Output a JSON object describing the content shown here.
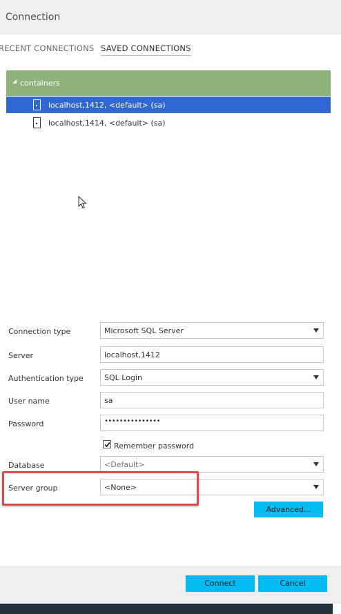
{
  "dialog": {
    "title": "Connection"
  },
  "tabs": [
    {
      "label": "RECENT CONNECTIONS",
      "active": false
    },
    {
      "label": "SAVED CONNECTIONS",
      "active": true
    }
  ],
  "tree": {
    "group_label": "containers",
    "items": [
      {
        "label": "localhost,1412, <default> (sa)",
        "selected": true,
        "icon": "server-icon"
      },
      {
        "label": "localhost,1414, <default> (sa)",
        "selected": false,
        "icon": "server-icon"
      }
    ]
  },
  "form": {
    "connection_type": {
      "label": "Connection type",
      "value": "Microsoft SQL Server"
    },
    "server": {
      "label": "Server",
      "value": "localhost,1412"
    },
    "auth_type": {
      "label": "Authentication type",
      "value": "SQL Login"
    },
    "user_name": {
      "label": "User name",
      "value": "sa"
    },
    "password": {
      "label": "Password",
      "value": "•••••••••••••••"
    },
    "remember_password": {
      "label": "Remember password",
      "checked": true
    },
    "database": {
      "label": "Database",
      "value": "<Default>"
    },
    "server_group": {
      "label": "Server group",
      "value": "<None>"
    },
    "advanced_label": "Advanced..."
  },
  "footer": {
    "connect_label": "Connect",
    "cancel_label": "Cancel"
  },
  "colors": {
    "group_header": "#8db37a",
    "selection": "#3067d3",
    "button": "#00bcf2",
    "highlight": "#e04a4a"
  }
}
